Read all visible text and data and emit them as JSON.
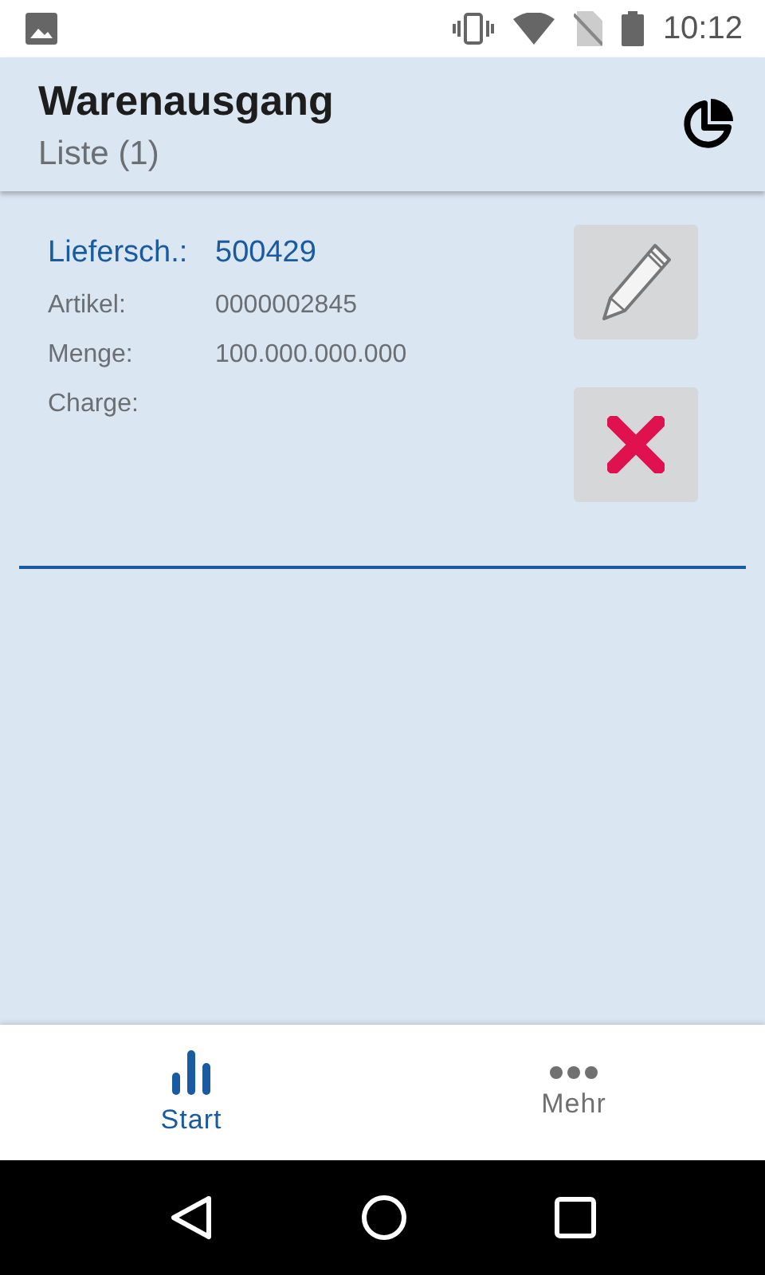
{
  "status_bar": {
    "time": "10:12"
  },
  "header": {
    "title": "Warenausgang",
    "subtitle": "Liste (1)"
  },
  "items": [
    {
      "heading_label": "Liefersch.:",
      "heading_value": "500429",
      "fields": [
        {
          "label": "Artikel:",
          "value": "0000002845"
        },
        {
          "label": "Menge:",
          "value": "100.000.000.000"
        },
        {
          "label": "Charge:"
        }
      ]
    }
  ],
  "bottom_nav": [
    {
      "kind": "bars",
      "label": "Start",
      "selected": true
    },
    {
      "kind": "dots",
      "label": "Mehr",
      "selected": false
    }
  ]
}
